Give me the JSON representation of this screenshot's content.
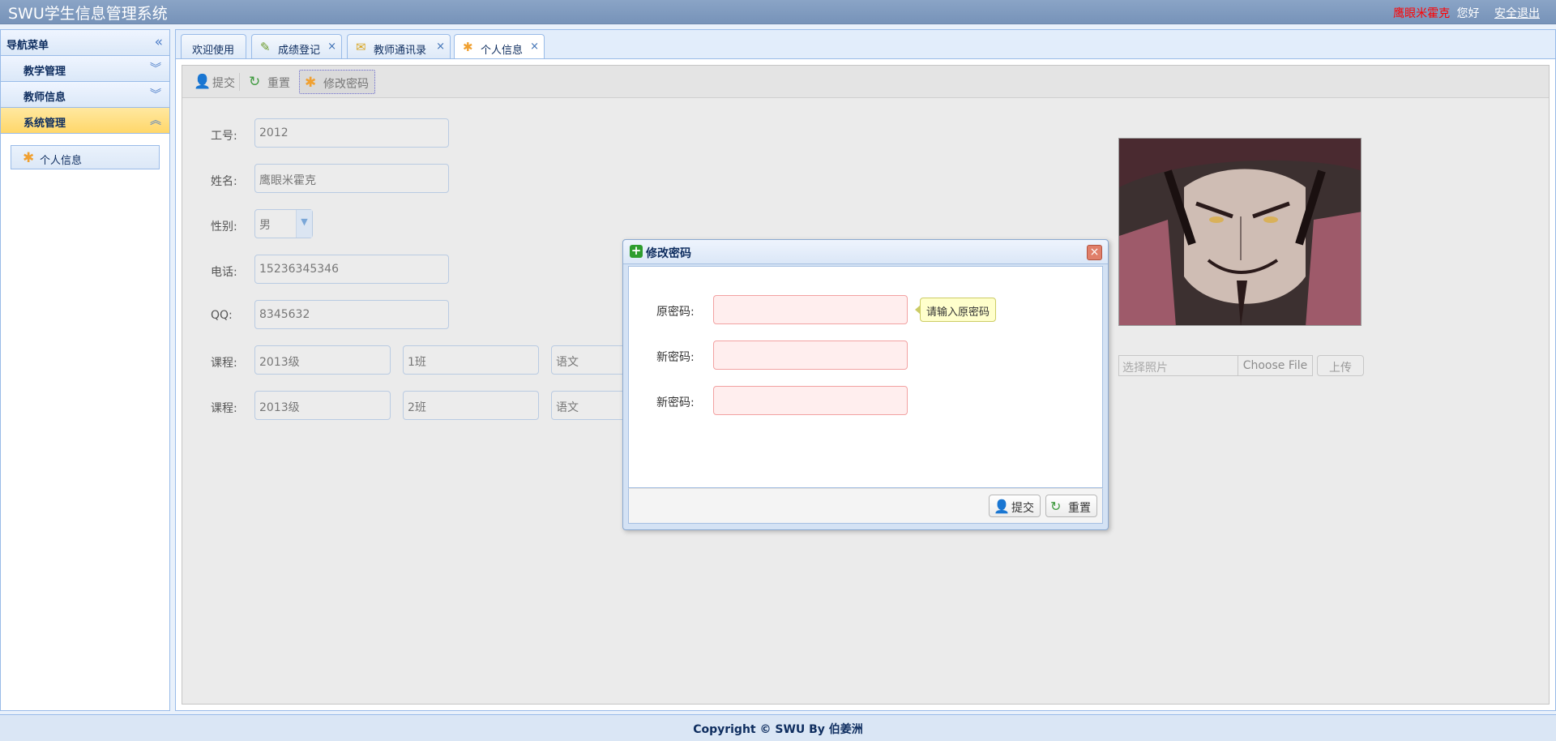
{
  "header": {
    "title": "SWU学生信息管理系统",
    "user_name": "鹰眼米霍克",
    "greeting": "您好",
    "logout": "安全退出"
  },
  "sidebar": {
    "title": "导航菜单",
    "sections": [
      {
        "label": "教学管理",
        "expanded": false
      },
      {
        "label": "教师信息",
        "expanded": false
      },
      {
        "label": "系统管理",
        "expanded": true
      }
    ],
    "items": [
      {
        "label": "个人信息"
      }
    ]
  },
  "tabs": [
    {
      "label": "欢迎使用",
      "closable": false
    },
    {
      "label": "成绩登记",
      "closable": true
    },
    {
      "label": "教师通讯录",
      "closable": true
    },
    {
      "label": "个人信息",
      "closable": true,
      "active": true
    }
  ],
  "toolbar": {
    "submit": "提交",
    "reset": "重置",
    "change_password": "修改密码"
  },
  "form": {
    "id_label": "工号:",
    "id_value": "2012",
    "name_label": "姓名:",
    "name_value": "鹰眼米霍克",
    "gender_label": "性别:",
    "gender_value": "男",
    "phone_label": "电话:",
    "phone_value": "15236345346",
    "qq_label": "QQ:",
    "qq_value": "8345632",
    "courses": [
      {
        "label": "课程:",
        "grade": "2013级",
        "class": "1班",
        "subject": "语文"
      },
      {
        "label": "课程:",
        "grade": "2013级",
        "class": "2班",
        "subject": "语文"
      }
    ]
  },
  "photo": {
    "file_placeholder": "选择照片",
    "choose_button": "Choose File",
    "upload_button": "上传"
  },
  "dialog": {
    "title": "修改密码",
    "old_password_label": "原密码:",
    "new_password_label": "新密码:",
    "confirm_password_label": "新密码:",
    "tooltip": "请输入原密码",
    "submit": "提交",
    "reset": "重置"
  },
  "footer": {
    "copyright": "Copyright © SWU By 伯姜洲"
  },
  "colors": {
    "header_bg": "#7f9bbf",
    "user_name": "#ff0000",
    "accordion_active": "#ffd76a",
    "invalid_input_bg": "#ffeeee",
    "invalid_input_border": "#f2a2a2",
    "tooltip_bg": "#ffffcc"
  }
}
